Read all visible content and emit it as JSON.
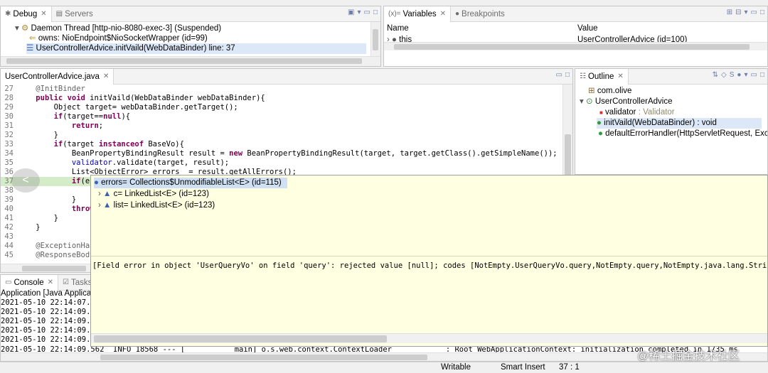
{
  "debug": {
    "tabs": [
      {
        "label": "Debug"
      },
      {
        "label": "Servers"
      }
    ],
    "thread": "Daemon Thread [http-nio-8080-exec-3] (Suspended)",
    "owns": "owns: NioEndpoint$NioSocketWrapper  (id=99)",
    "frame": "UserControllerAdvice.initVaild(WebDataBinder) line: 37"
  },
  "variables": {
    "tabs": [
      {
        "label": "Variables"
      },
      {
        "label": "Breakpoints"
      }
    ],
    "col_name": "Name",
    "col_value": "Value",
    "row_name": "this",
    "row_value": "UserControllerAdvice  (id=100)"
  },
  "editor": {
    "tab": "UserControllerAdvice.java",
    "lines": [
      {
        "n": "27",
        "t": "    @InitBinder"
      },
      {
        "n": "28",
        "t": "    public void initVaild(WebDataBinder webDataBinder){"
      },
      {
        "n": "29",
        "t": "        Object target= webDataBinder.getTarget();"
      },
      {
        "n": "30",
        "t": "        if(target==null){"
      },
      {
        "n": "31",
        "t": "            return;"
      },
      {
        "n": "32",
        "t": "        }"
      },
      {
        "n": "33",
        "t": "        if(target instanceof BaseVo){"
      },
      {
        "n": "34",
        "t": "            BeanPropertyBindingResult result = new BeanPropertyBindingResult(target, target.getClass().getSimpleName());"
      },
      {
        "n": "35",
        "t": "            validator.validate(target, result);"
      },
      {
        "n": "36",
        "t": "            List<ObjectError> errors  = result.getAllErrors();"
      },
      {
        "n": "37",
        "t": "            if(er"
      },
      {
        "n": "38",
        "t": "                r"
      },
      {
        "n": "39",
        "t": "            }"
      },
      {
        "n": "40",
        "t": "            throw"
      },
      {
        "n": "41",
        "t": "        }"
      },
      {
        "n": "42",
        "t": "    }"
      },
      {
        "n": "43",
        "t": ""
      },
      {
        "n": "44",
        "t": "    @ExceptionHan"
      },
      {
        "n": "45",
        "t": "    @ResponseBody"
      }
    ]
  },
  "outline": {
    "tab": "Outline",
    "items": [
      {
        "label": "com.olive",
        "detail": ""
      },
      {
        "label": "UserControllerAdvice",
        "detail": ""
      },
      {
        "label": "validator",
        "detail": " : Validator"
      },
      {
        "label": "initVaild(WebDataBinder) : void",
        "detail": ""
      },
      {
        "label": "defaultErrorHandler(HttpServletRequest, Exce",
        "detail": ""
      }
    ]
  },
  "console": {
    "tabs": [
      {
        "label": "Console"
      },
      {
        "label": "Tasks"
      }
    ],
    "header": "Application [Java Applicatio",
    "lines": [
      "2021-05-10 22:14:07.7",
      "2021-05-10 22:14:09.4",
      "2021-05-10 22:14:09.4",
      "2021-05-10 22:14:09.4",
      "2021-05-10 22:14:09.5"
    ],
    "last_line": "2021-05-10 22:14:09.562  INFO 18568 --- [           main] o.s.web.context.ContextLoader            : Root WebApplicationContext: initialization completed in 1735 ms"
  },
  "popup": {
    "items": [
      {
        "label": "errors= Collections$UnmodifiableList<E>  (id=115)"
      },
      {
        "label": "c= LinkedList<E>  (id=123)"
      },
      {
        "label": "list= LinkedList<E>  (id=123)"
      }
    ],
    "detail": "[Field error in object 'UserQueryVo' on field 'query': rejected value [null]; codes [NotEmpty.UserQueryVo.query,NotEmpty.query,NotEmpty.java.lang.Strin"
  },
  "status": {
    "writable": "Writable",
    "insert_mode": "Smart Insert",
    "position": "37 : 1"
  },
  "watermark": "@稀土掘金技术社区"
}
